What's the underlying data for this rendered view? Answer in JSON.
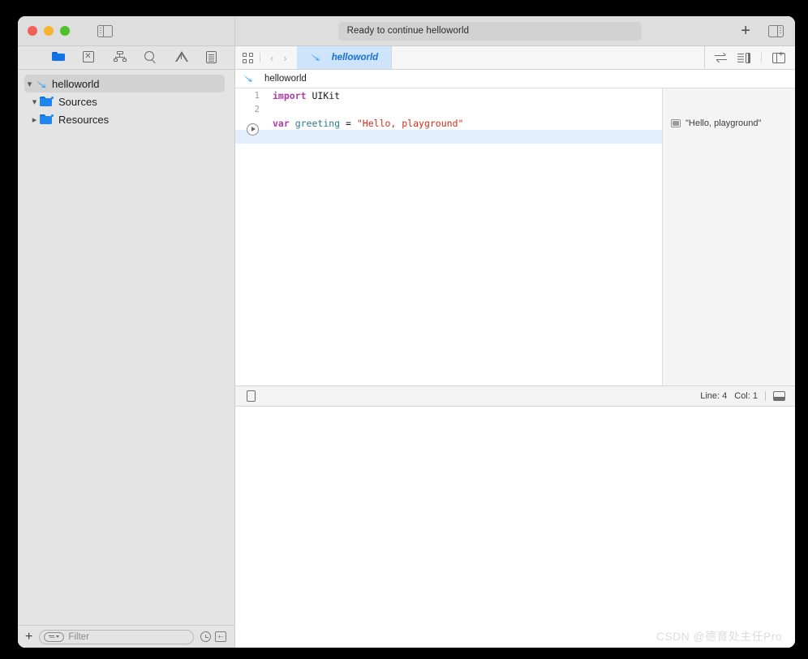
{
  "window": {
    "traffic_lights": [
      "close",
      "minimize",
      "zoom"
    ],
    "colors": {
      "close": "#f05e57",
      "minimize": "#f5b32f",
      "zoom": "#4fc12a",
      "accent_blue": "#1a6fd4",
      "tab_active_bg": "#cde4fb",
      "keyword": "#ad3da4",
      "string": "#d12f1b",
      "identifier": "#2b7c8c",
      "current_line": "#e3efff"
    }
  },
  "toolbar": {
    "sidebar_toggle_label": "Hide or show the Navigator",
    "activity_status": "Ready to continue helloworld",
    "add_label": "+",
    "inspector_toggle_label": "Hide or show the Inspectors"
  },
  "navigator": {
    "tabs": [
      {
        "name": "project-navigator",
        "icon": "folder-icon",
        "selected": true
      },
      {
        "name": "source-control-navigator",
        "icon": "source-control-icon",
        "selected": false
      },
      {
        "name": "symbol-navigator",
        "icon": "hierarchy-icon",
        "selected": false
      },
      {
        "name": "find-navigator",
        "icon": "search-icon",
        "selected": false
      },
      {
        "name": "issue-navigator",
        "icon": "warning-icon",
        "selected": false
      },
      {
        "name": "report-navigator",
        "icon": "report-icon",
        "selected": false
      }
    ],
    "tree": [
      {
        "label": "helloworld",
        "icon": "swift-playground-icon",
        "indent": 0,
        "disclosure": "open",
        "selected": true
      },
      {
        "label": "Sources",
        "icon": "folder-icon",
        "indent": 1,
        "disclosure": "open",
        "selected": false
      },
      {
        "label": "Resources",
        "icon": "folder-icon",
        "indent": 1,
        "disclosure": "closed",
        "selected": false
      }
    ],
    "filter_bar": {
      "add_label": "+",
      "filter_placeholder": "Filter",
      "recent_icon": "clock-icon",
      "toggle_icon": "expand-collapse-icon"
    }
  },
  "editor": {
    "tabbar": {
      "grid_icon": "tab-overview-icon",
      "back_arrow": "‹",
      "forward_arrow": "›",
      "tabs": [
        {
          "label": "helloworld",
          "icon": "swift-playground-icon",
          "active": true
        }
      ],
      "right_icons": [
        {
          "name": "adjust-editor-icon"
        },
        {
          "name": "editor-options-icon"
        },
        {
          "name": "add-editor-icon"
        }
      ]
    },
    "jumpbar": {
      "icon": "swift-playground-icon",
      "path": "helloworld"
    },
    "code": {
      "language": "swift",
      "lines": [
        {
          "number": "1",
          "current": false,
          "run_button": false,
          "tokens": [
            {
              "text": "import ",
              "type": "keyword"
            },
            {
              "text": "UIKit",
              "type": "plain"
            }
          ]
        },
        {
          "number": "2",
          "current": false,
          "run_button": false,
          "tokens": []
        },
        {
          "number": "",
          "current": false,
          "run_button": false,
          "tokens": [
            {
              "text": "var ",
              "type": "keyword"
            },
            {
              "text": "greeting",
              "type": "identifier"
            },
            {
              "text": " = ",
              "type": "plain"
            },
            {
              "text": "\"Hello, playground\"",
              "type": "string"
            }
          ]
        },
        {
          "number": "",
          "current": true,
          "run_button": true,
          "tokens": []
        }
      ]
    },
    "results": [
      {
        "line_index": 2,
        "icon": "quick-look-icon",
        "value": "\"Hello, playground\""
      }
    ],
    "status_bar": {
      "stop_icon": "stop-icon",
      "line_label": "Line: 4",
      "col_label": "Col: 1",
      "console_icon": "console-toggle-icon"
    }
  },
  "watermark": {
    "text": "CSDN @德育处主任Pro"
  }
}
